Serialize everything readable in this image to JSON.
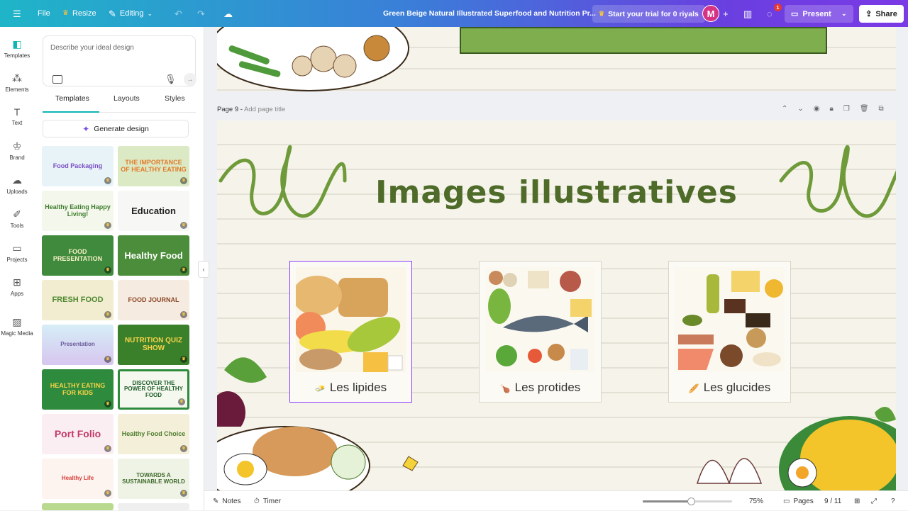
{
  "topbar": {
    "file": "File",
    "resize": "Resize",
    "editing": "Editing",
    "doc_title": "Green Beige Natural Illustrated Superfood and Nutrition Pr...",
    "trial": "Start your trial for 0 riyals",
    "avatar_letter": "M",
    "notif_count": "1",
    "present": "Present",
    "share": "Share"
  },
  "rail": {
    "items": [
      {
        "label": "Templates",
        "icon": "templates-icon"
      },
      {
        "label": "Elements",
        "icon": "elements-icon"
      },
      {
        "label": "Text",
        "icon": "text-icon"
      },
      {
        "label": "Brand",
        "icon": "brand-icon"
      },
      {
        "label": "Uploads",
        "icon": "uploads-icon"
      },
      {
        "label": "Tools",
        "icon": "tools-icon"
      },
      {
        "label": "Projects",
        "icon": "projects-icon"
      },
      {
        "label": "Apps",
        "icon": "apps-icon"
      },
      {
        "label": "Magic Media",
        "icon": "magic-media-icon"
      }
    ]
  },
  "panel": {
    "search_placeholder": "Describe your ideal design",
    "tabs": [
      "Templates",
      "Layouts",
      "Styles"
    ],
    "generate": "Generate design",
    "thumbnails": [
      "Food Packaging",
      "THE IMPORTANCE OF HEALTHY EATING",
      "Healthy Eating Happy Living!",
      "Education",
      "FOOD PRESENTATION",
      "Healthy Food",
      "FRESH FOOD",
      "FOOD JOURNAL",
      "Presentation",
      "NUTRITION QUIZ SHOW",
      "HEALTHY EATING FOR KIDS",
      "DISCOVER THE POWER OF HEALTHY FOOD",
      "Port Folio",
      "Healthy Food Choice",
      "Healthy Life",
      "TOWARDS A SUSTAINABLE WORLD"
    ]
  },
  "canvas": {
    "page_label": "Page 9 - ",
    "page_add_title": "Add page title",
    "slide_title": "Images illustratives",
    "cards": [
      {
        "label": "Les lipides",
        "emoji": "🧈"
      },
      {
        "label": "Les protides",
        "emoji": "🍗"
      },
      {
        "label": "Les glucides",
        "emoji": "🥖"
      }
    ]
  },
  "bottombar": {
    "notes": "Notes",
    "timer": "Timer",
    "zoom": "75%",
    "zoom_fraction": 0.54,
    "pages": "Pages",
    "page_count": "9 / 11"
  },
  "colors": {
    "accent": "#8b3dff",
    "teal": "#0fb5b5",
    "title_green": "#4e6b2a"
  }
}
